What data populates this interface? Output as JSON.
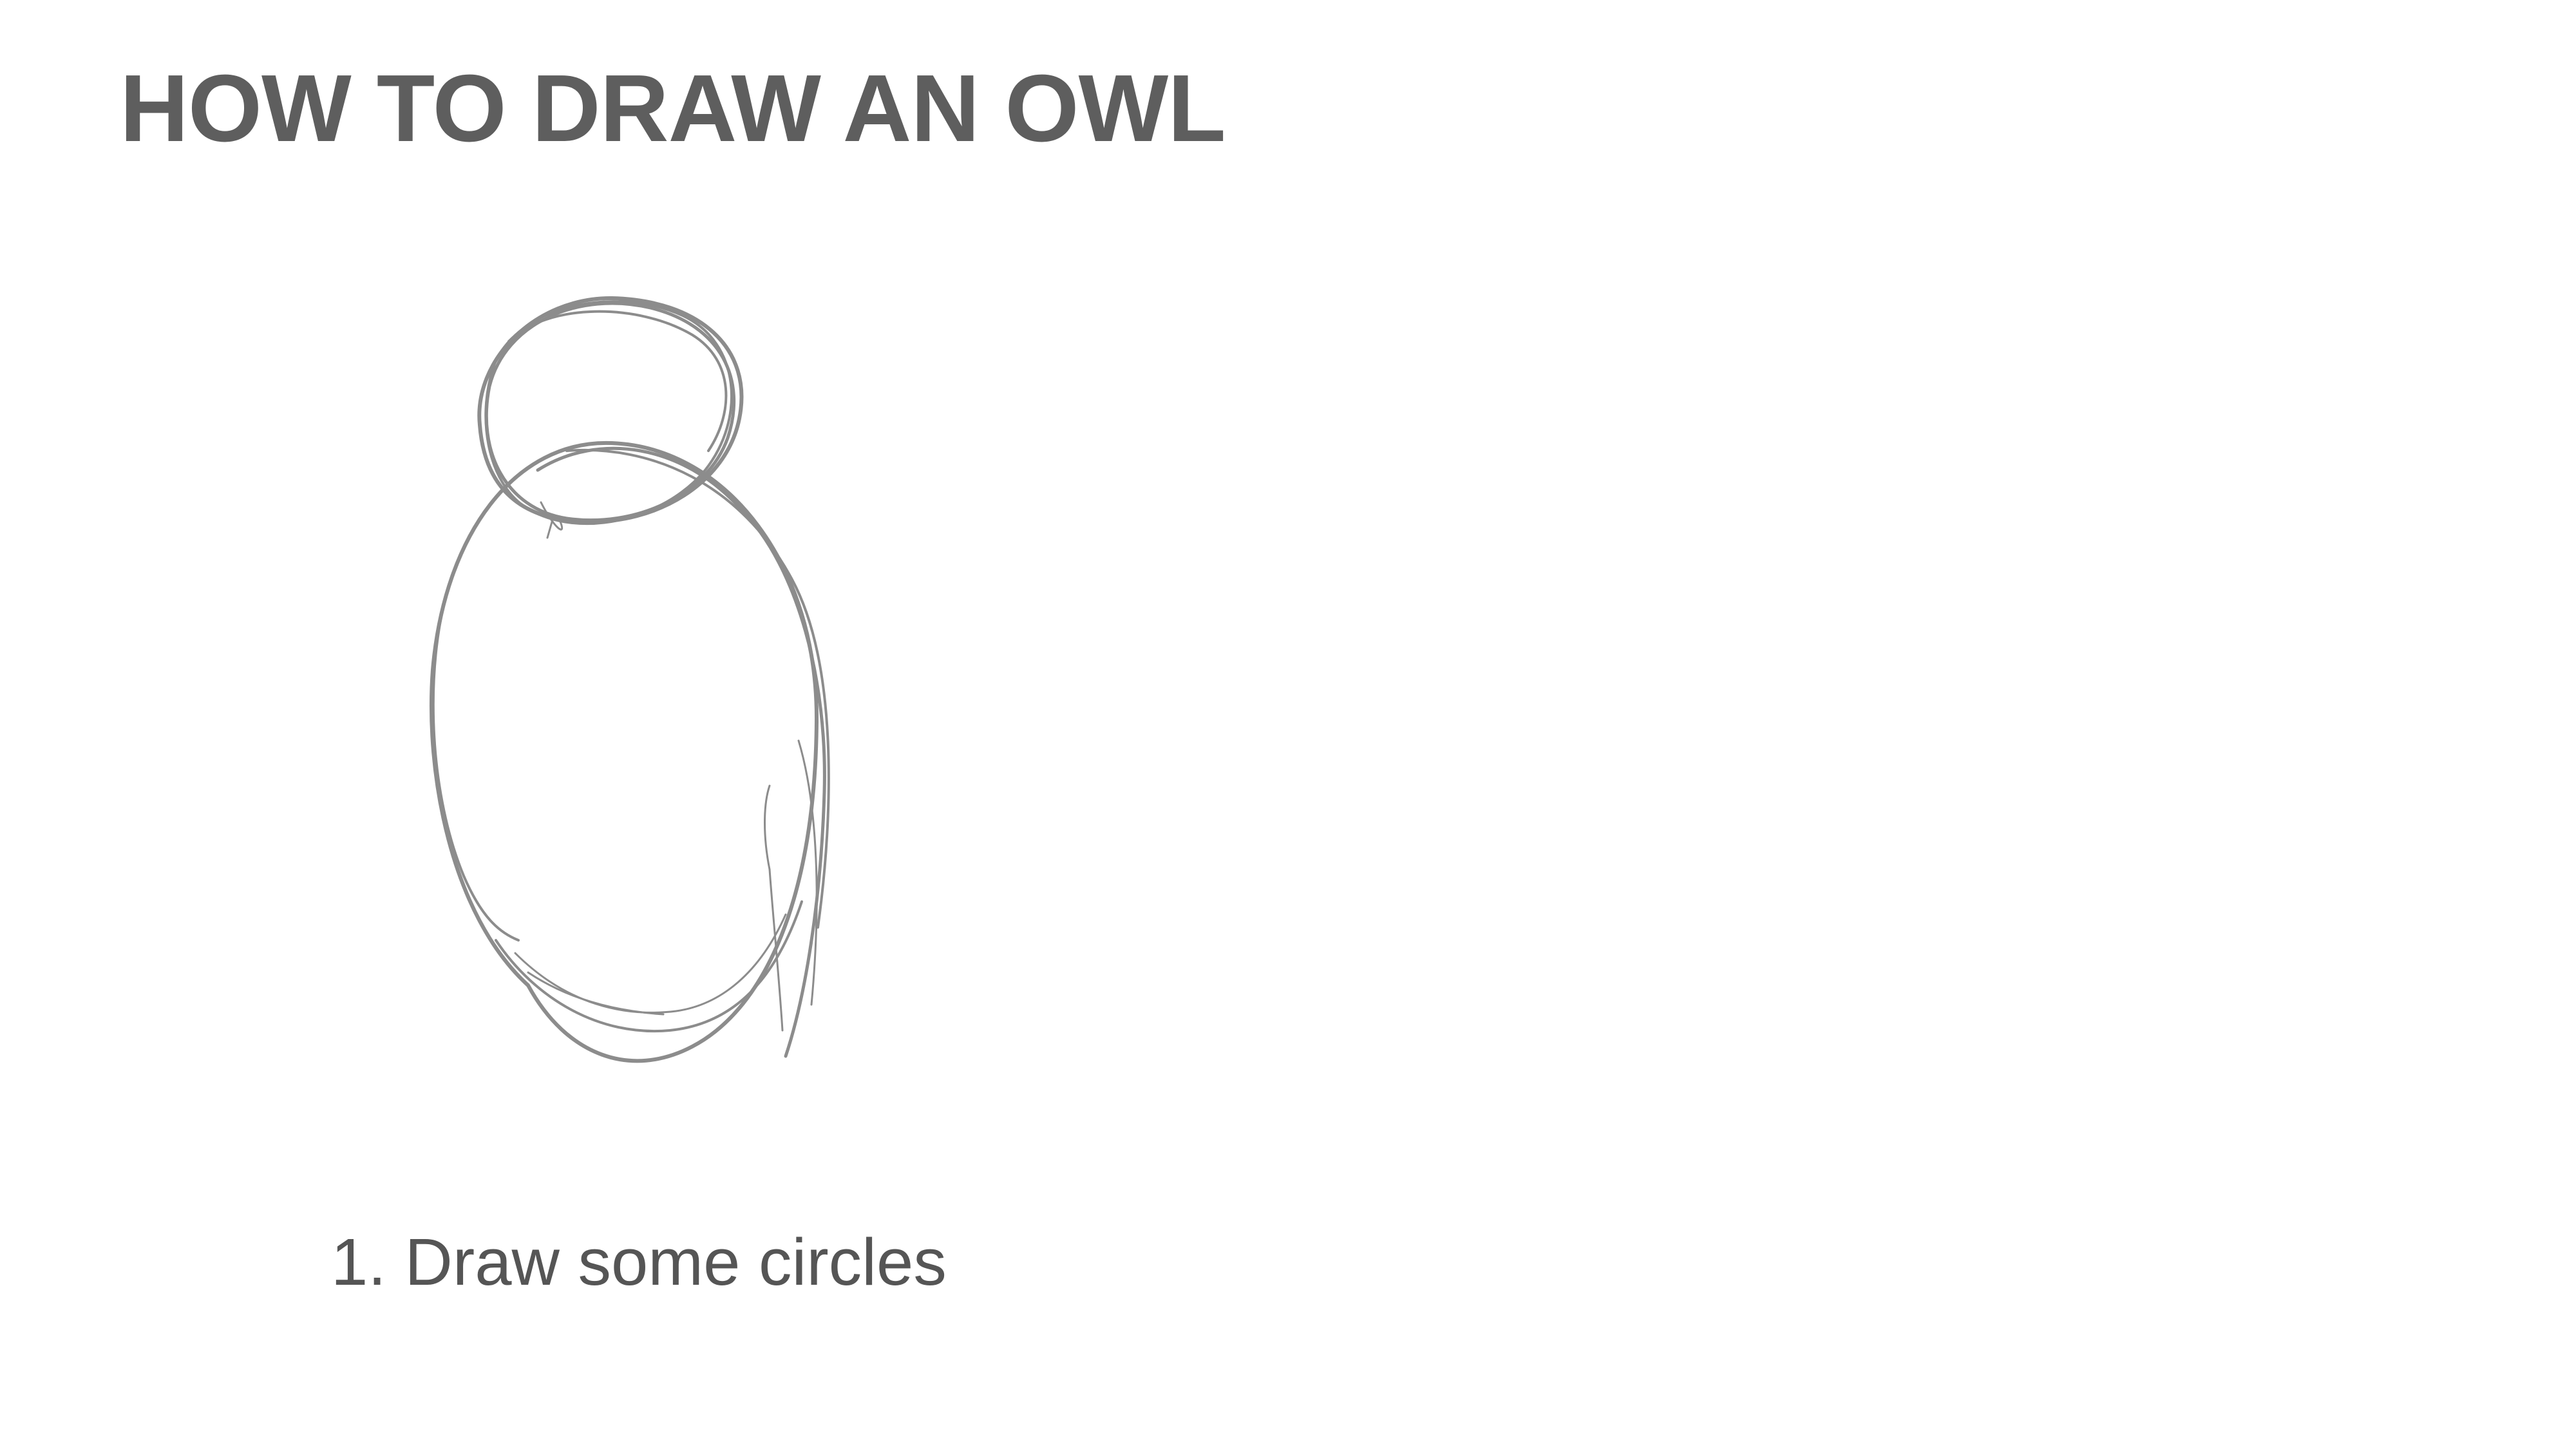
{
  "slide": {
    "title": "HOW TO DRAW AN OWL",
    "caption": "1. Draw some circles"
  },
  "illustration": {
    "icon": "owl-sketch-circles-icon",
    "stroke_color": "#8c8c8c"
  },
  "colors": {
    "background": "#ffffff",
    "title_text": "#5e5e5e",
    "caption_text": "#555555"
  }
}
